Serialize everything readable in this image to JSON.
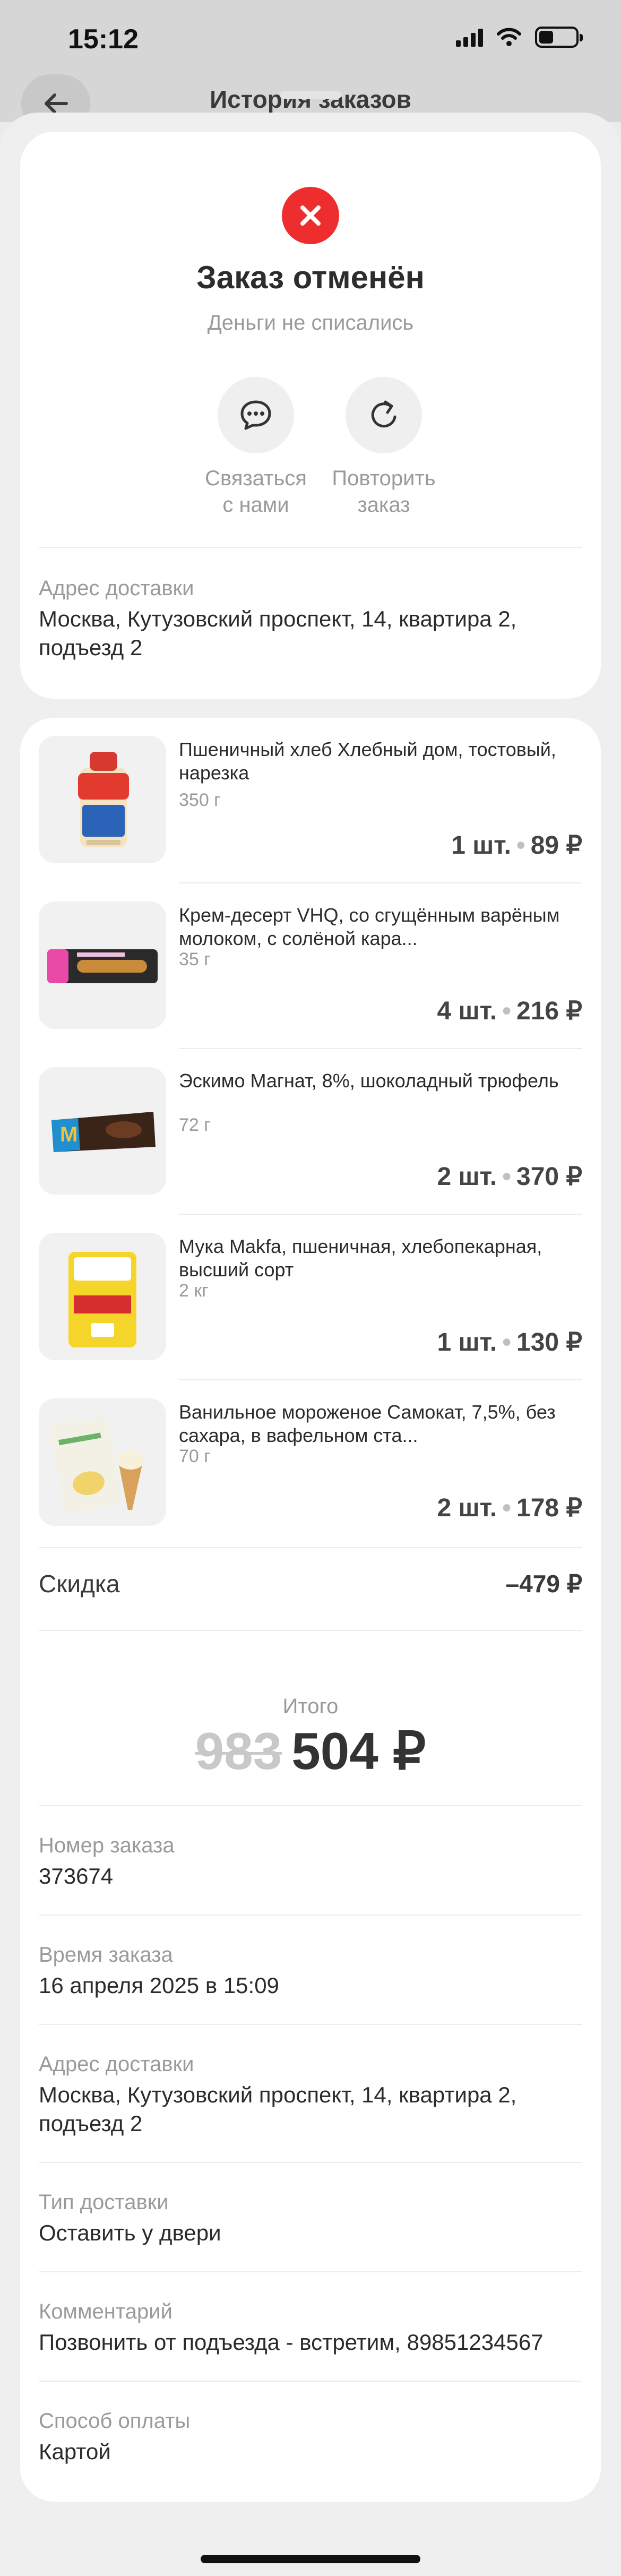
{
  "status_bar": {
    "time": "15:12"
  },
  "header": {
    "title": "История заказов"
  },
  "order_status": {
    "title": "Заказ отменён",
    "subtitle": "Деньги не списались",
    "actions": [
      {
        "label": "Связаться\nс нами",
        "icon": "chat-bubble-icon"
      },
      {
        "label": "Повторить\nзаказ",
        "icon": "refresh-icon"
      }
    ],
    "address_label": "Адрес доставки",
    "address_value": "Москва, Кутузовский проспект, 14, квартира 2, подъезд 2"
  },
  "items": [
    {
      "name": "Пшеничный хлеб Хлебный дом, тостовый, нарезка",
      "weight": "350 г",
      "qty": "1 шт.",
      "price": "89 ₽"
    },
    {
      "name": "Крем-десерт VHQ, со сгущённым варёным молоком, с солёной кара...",
      "weight": "35 г",
      "qty": "4 шт.",
      "price": "216 ₽"
    },
    {
      "name": "Эскимо Магнат, 8%, шоколадный трюфель",
      "weight": "72 г",
      "qty": "2 шт.",
      "price": "370 ₽"
    },
    {
      "name": "Мука Makfa, пшеничная, хлебопекарная, высший сорт",
      "weight": "2 кг",
      "qty": "1 шт.",
      "price": "130 ₽"
    },
    {
      "name": "Ванильное мороженое Самокат, 7,5%, без сахара, в вафельном ста...",
      "weight": "70 г",
      "qty": "2 шт.",
      "price": "178 ₽"
    }
  ],
  "discount": {
    "label": "Скидка",
    "value": "–479 ₽"
  },
  "total": {
    "label": "Итого",
    "old": "983",
    "new": "504 ₽"
  },
  "details": [
    {
      "label": "Номер заказа",
      "value": "373674"
    },
    {
      "label": "Время заказа",
      "value": "16 апреля 2025 в 15:09"
    },
    {
      "label": "Адрес доставки",
      "value": "Москва, Кутузовский проспект, 14, квартира 2, подъезд 2"
    },
    {
      "label": "Тип доставки",
      "value": "Оставить у двери"
    },
    {
      "label": "Комментарий",
      "value": "Позвонить от подъезда - встретим, 89851234567"
    },
    {
      "label": "Способ оплаты",
      "value": "Картой"
    }
  ],
  "colors": {
    "accent_red": "#ee2e2e",
    "sheet_bg": "#efefef",
    "card_bg": "#ffffff"
  }
}
